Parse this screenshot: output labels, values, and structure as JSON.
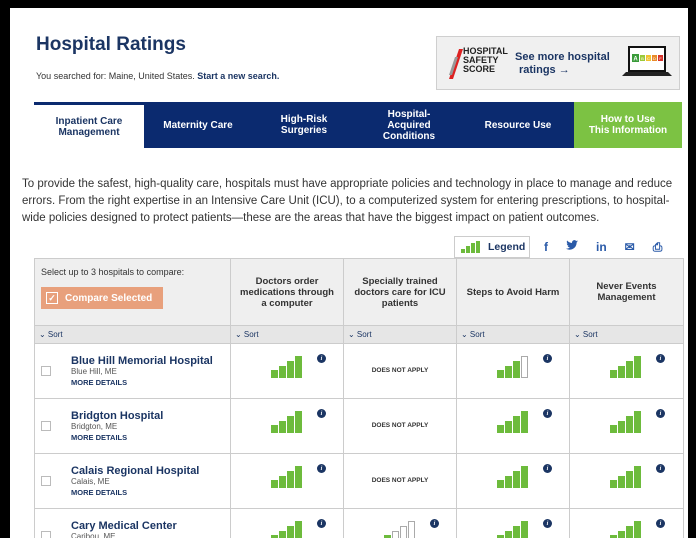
{
  "header": {
    "title": "Hospital Ratings",
    "searched_prefix": "You searched for: Maine, United States.",
    "new_search": "Start a new search."
  },
  "ad": {
    "logo_line1": "HOSPITAL",
    "logo_line2": "SAFETY",
    "logo_line3": "SCORE",
    "link_line1": "See more hospital",
    "link_line2": "ratings →",
    "icon": "laptop-grade-icon",
    "grades": [
      "A",
      "B",
      "C",
      "D",
      "F"
    ]
  },
  "nav": {
    "tabs": [
      {
        "line1": "Inpatient Care",
        "line2": "Management",
        "line3": ""
      },
      {
        "line1": "Maternity Care",
        "line2": "",
        "line3": ""
      },
      {
        "line1": "High-Risk",
        "line2": "Surgeries",
        "line3": ""
      },
      {
        "line1": "Hospital-",
        "line2": "Acquired",
        "line3": "Conditions"
      },
      {
        "line1": "Resource Use",
        "line2": "",
        "line3": ""
      },
      {
        "line1": "How to Use",
        "line2": "This Information",
        "line3": ""
      }
    ]
  },
  "intro": "To provide the safest, high-quality care, hospitals must have appropriate policies and technology in place to manage and reduce errors. From the right expertise in an Intensive Care Unit (ICU), to a computerized system for entering prescriptions, to hospital-wide policies designed to protect patients—these are the areas that have the biggest impact on patient outcomes.",
  "toolbar": {
    "legend_label": "Legend",
    "social": [
      "f",
      "t",
      "in",
      "✉",
      "⎙"
    ]
  },
  "table": {
    "select_label": "Select up to 3 hospitals to compare:",
    "compare_label": "Compare Selected",
    "compare_check": "✓",
    "columns": [
      {
        "line1": "Doctors order",
        "line2": "medications through",
        "line3": "a computer"
      },
      {
        "line1": "Specially trained",
        "line2": "doctors care for ICU",
        "line3": "patients"
      },
      {
        "line1": "Steps to Avoid Harm",
        "line2": "",
        "line3": ""
      },
      {
        "line1": "Never Events",
        "line2": "Management",
        "line3": ""
      }
    ],
    "sort_label": "⌄ Sort",
    "more_details": "MORE DETAILS",
    "does_not_apply": "DOES NOT APPLY",
    "info_glyph": "i",
    "rows": [
      {
        "name": "Blue Hill Memorial Hospital",
        "city": "Blue Hill, ME",
        "ratings": [
          4,
          null,
          3,
          4
        ]
      },
      {
        "name": "Bridgton Hospital",
        "city": "Bridgton, ME",
        "ratings": [
          4,
          null,
          4,
          4
        ]
      },
      {
        "name": "Calais Regional Hospital",
        "city": "Calais, ME",
        "ratings": [
          4,
          null,
          4,
          4
        ]
      },
      {
        "name": "Cary Medical Center",
        "city": "Caribou, ME",
        "ratings": [
          4,
          1,
          4,
          4
        ]
      }
    ]
  },
  "colors": {
    "navy": "#0b2a6f",
    "green": "#7cc243",
    "bar_green": "#6dbb3c",
    "compare": "#e8a07c"
  }
}
